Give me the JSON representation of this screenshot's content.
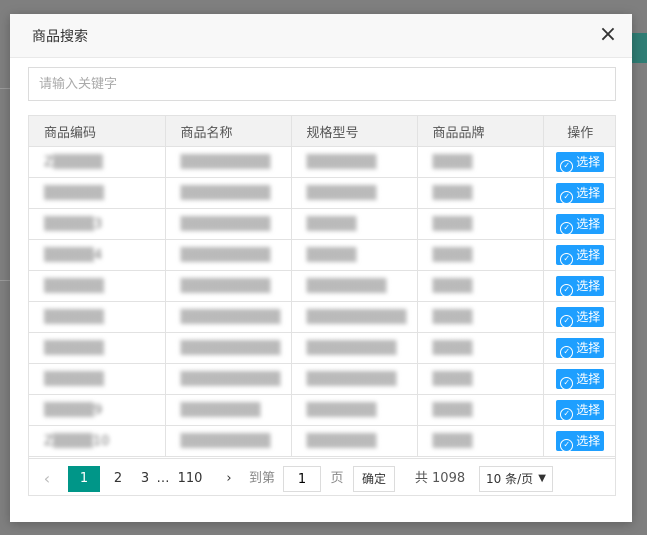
{
  "modal": {
    "title": "商品搜索",
    "close_glyph": "×",
    "search_placeholder": "请输入关键字"
  },
  "table": {
    "headers": [
      "商品编码",
      "商品名称",
      "规格型号",
      "商品品牌",
      "操作"
    ],
    "select_label": "选择",
    "rows": [
      {
        "code": "Z▒▒▒▒▒",
        "name": "▒▒▒▒▒▒▒▒▒",
        "spec": "▒▒▒▒▒▒▒",
        "brand": "▒▒▒▒"
      },
      {
        "code": "▒▒▒▒▒▒",
        "name": "▒▒▒▒▒▒▒▒▒",
        "spec": "▒▒▒▒▒▒▒",
        "brand": "▒▒▒▒"
      },
      {
        "code": "▒▒▒▒▒3",
        "name": "▒▒▒▒▒▒▒▒▒",
        "spec": "▒▒▒▒▒",
        "brand": "▒▒▒▒"
      },
      {
        "code": "▒▒▒▒▒4",
        "name": "▒▒▒▒▒▒▒▒▒",
        "spec": "▒▒▒▒▒",
        "brand": "▒▒▒▒"
      },
      {
        "code": "▒▒▒▒▒▒",
        "name": "▒▒▒▒▒▒▒▒▒",
        "spec": "▒▒▒▒▒▒▒▒",
        "brand": "▒▒▒▒"
      },
      {
        "code": "▒▒▒▒▒▒",
        "name": "▒▒▒▒▒▒▒▒▒▒",
        "spec": "▒▒▒▒▒▒▒▒▒▒",
        "brand": "▒▒▒▒"
      },
      {
        "code": "▒▒▒▒▒▒",
        "name": "▒▒▒▒▒▒▒▒▒▒",
        "spec": "▒▒▒▒▒▒▒▒▒",
        "brand": "▒▒▒▒"
      },
      {
        "code": "▒▒▒▒▒▒",
        "name": "▒▒▒▒▒▒▒▒▒▒",
        "spec": "▒▒▒▒▒▒▒▒▒",
        "brand": "▒▒▒▒"
      },
      {
        "code": "▒▒▒▒▒9",
        "name": "▒▒▒▒▒▒▒▒",
        "spec": "▒▒▒▒▒▒▒",
        "brand": "▒▒▒▒"
      },
      {
        "code": "Z▒▒▒▒10",
        "name": "▒▒▒▒▒▒▒▒▒",
        "spec": "▒▒▒▒▒▒▒",
        "brand": "▒▒▒▒"
      }
    ]
  },
  "pager": {
    "prev": "‹",
    "pages": [
      "1",
      "2",
      "3"
    ],
    "ellipsis": "…",
    "last_page": "110",
    "next": "›",
    "goto_label": "到第",
    "goto_value": "1",
    "page_unit": "页",
    "confirm_label": "确定",
    "total_label": "共 1098 条",
    "per_page_label": "10 条/页",
    "per_page_caret": "▼",
    "active_page": "1",
    "active_color": "#009688"
  },
  "colors": {
    "overlay": "#7f7f7f",
    "select_button": "#1e9fff"
  }
}
